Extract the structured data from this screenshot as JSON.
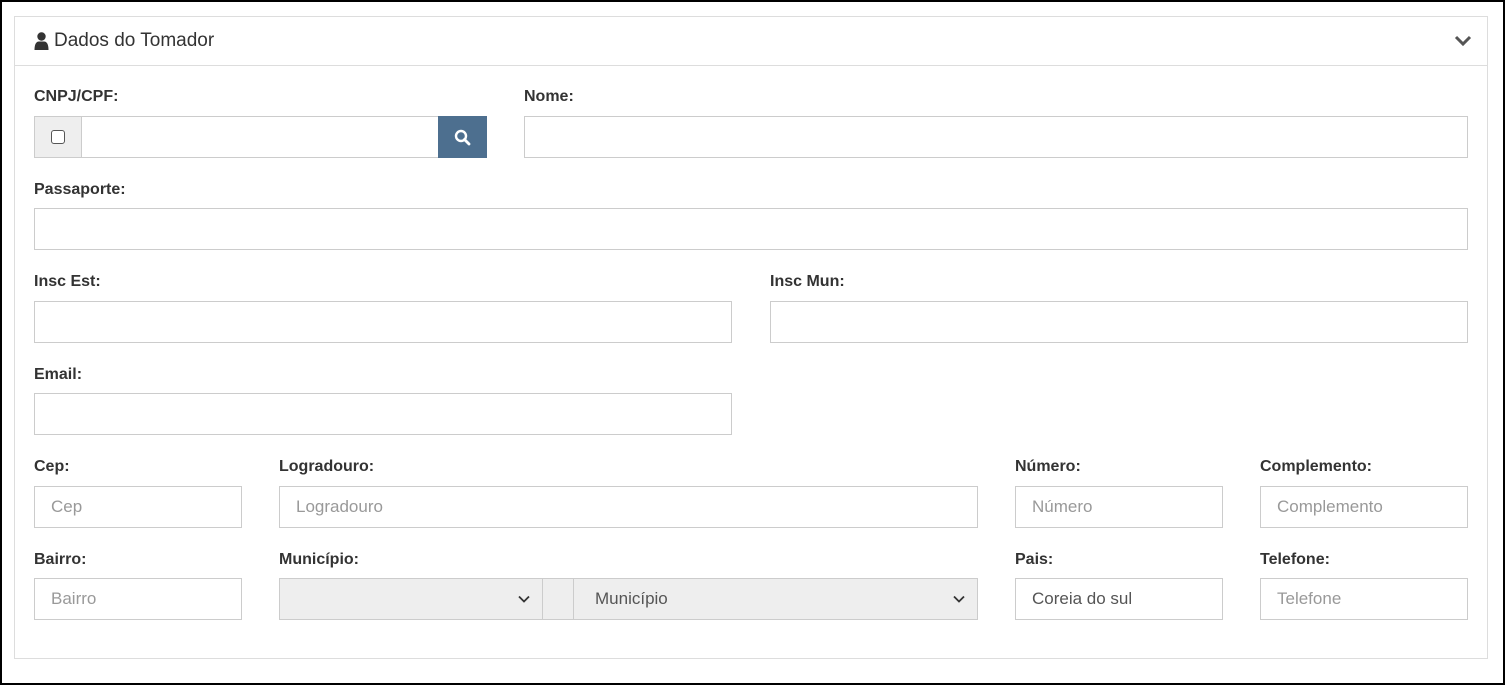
{
  "panel": {
    "title": "Dados do Tomador",
    "icons": {
      "title": "user-icon",
      "collapse": "chevron-down-icon"
    }
  },
  "form": {
    "cnpj": {
      "label": "CNPJ/CPF:",
      "value": "",
      "checkbox_checked": false,
      "button_icon": "search-icon"
    },
    "nome": {
      "label": "Nome:",
      "value": ""
    },
    "passaporte": {
      "label": "Passaporte:",
      "value": ""
    },
    "insc_est": {
      "label": "Insc Est:",
      "value": ""
    },
    "insc_mun": {
      "label": "Insc Mun:",
      "value": ""
    },
    "email": {
      "label": "Email:",
      "value": ""
    },
    "cep": {
      "label": "Cep:",
      "placeholder": "Cep"
    },
    "logradouro": {
      "label": "Logradouro:",
      "placeholder": "Logradouro"
    },
    "numero": {
      "label": "Número:",
      "placeholder": "Número"
    },
    "complemento": {
      "label": "Complemento:",
      "placeholder": "Complemento"
    },
    "bairro": {
      "label": "Bairro:",
      "placeholder": "Bairro"
    },
    "municipio": {
      "label": "Município:",
      "uf_selected": "",
      "selected": "Município"
    },
    "pais": {
      "label": "Pais:",
      "value": "Coreia do sul"
    },
    "telefone": {
      "label": "Telefone:",
      "placeholder": "Telefone"
    }
  },
  "colors": {
    "search_button": "#4d6f8f",
    "border": "#cccccc",
    "disabled_bg": "#eeeeee"
  }
}
